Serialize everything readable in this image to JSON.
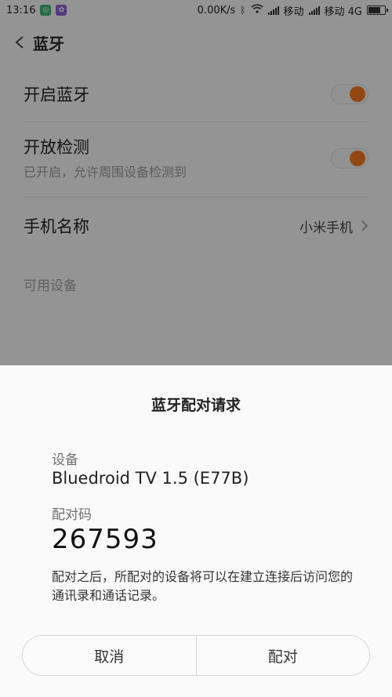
{
  "status": {
    "time": "13:16",
    "speed": "0.00K/s",
    "carrier1": "移动",
    "carrier2": "移动 4G"
  },
  "header": {
    "title": "蓝牙"
  },
  "settings": {
    "bluetooth": {
      "label": "开启蓝牙",
      "enabled": true
    },
    "discoverable": {
      "label": "开放检测",
      "sub": "已开启，允许周围设备检测到",
      "enabled": true
    },
    "phone_name": {
      "label": "手机名称",
      "value": "小米手机"
    },
    "available_section": "可用设备"
  },
  "dialog": {
    "title": "蓝牙配对请求",
    "device_label": "设备",
    "device_name": "Bluedroid TV 1.5 (E77B)",
    "code_label": "配对码",
    "code": "267593",
    "note": "配对之后，所配对的设备将可以在建立连接后访问您的通讯录和通话记录。",
    "cancel_label": "取消",
    "pair_label": "配对"
  },
  "colors": {
    "accent": "#f47920"
  }
}
